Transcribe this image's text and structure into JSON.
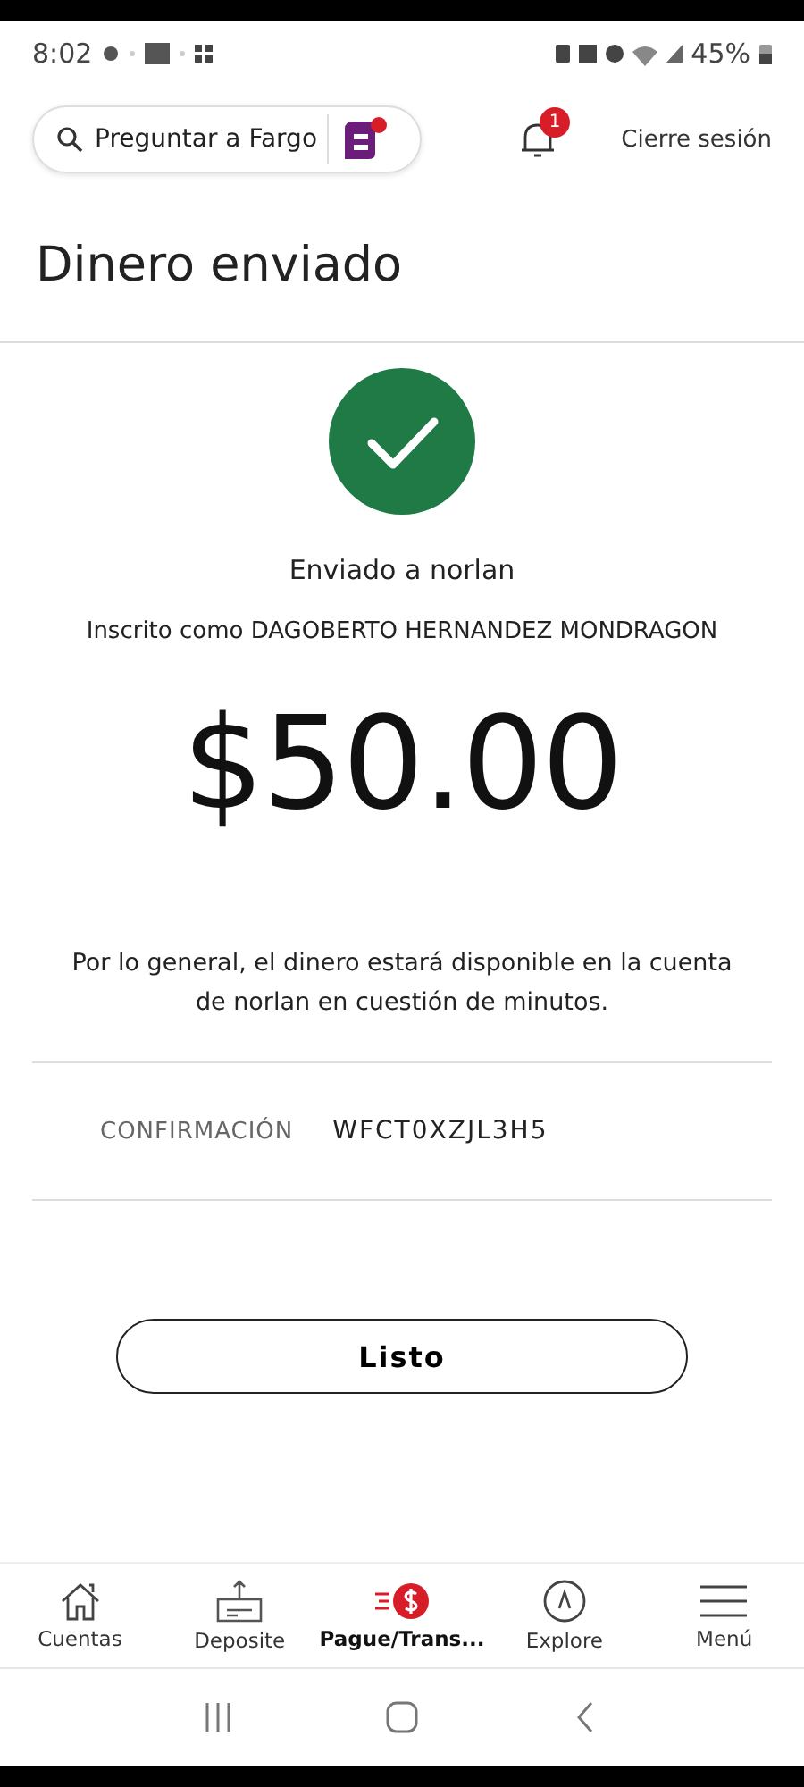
{
  "status_bar": {
    "time": "8:02",
    "battery": "45%"
  },
  "header": {
    "search": {
      "placeholder": "Preguntar a Fargo"
    },
    "notifications": {
      "count": "1"
    },
    "logout": "Cierre sesión"
  },
  "title": "Dinero enviado",
  "result": {
    "recipient": "Enviado a norlan",
    "enrolled_as": "Inscrito como DAGOBERTO HERNANDEZ MONDRAGON",
    "amount": "$50.00",
    "note": "Por lo general, el dinero estará disponible en la cuenta de norlan en cuestión de minutos."
  },
  "confirmation": {
    "label": "CONFIRMACIÓN",
    "value": "WFCT0XZJL3H5"
  },
  "done_button": "Listo",
  "bottom_nav": [
    {
      "label": "Cuentas",
      "selected": false
    },
    {
      "label": "Deposite",
      "selected": false
    },
    {
      "label": "Pague/Trans...",
      "selected": true
    },
    {
      "label": "Explore",
      "selected": false
    },
    {
      "label": "Menú",
      "selected": false
    }
  ]
}
